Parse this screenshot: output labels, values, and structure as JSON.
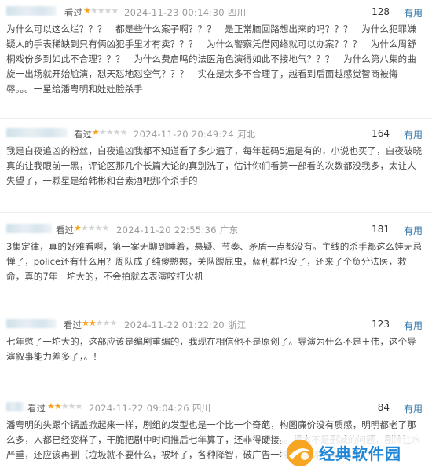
{
  "reviews": [
    {
      "status": "看过",
      "stars": 1,
      "date": "2024-11-23 00:14:30",
      "location": "四川",
      "useful_count": "128",
      "useful_label": "有用",
      "text": "为什么可以这么烂？？？　都是些什么案子啊？？？　是正常脑回路想出来的吗？？？　为什么犯罪嫌疑人的手表稀缺到只有俩凶犯手里才有卖？？？　为什么警察凭借网络就可以办案？？？　为什么周舒桐戏份多到如此不合理？？？　为什么费启鸣的法医角色演得如此不接地气？？？　为什么第八集的曲旋一出场就开始尬演，怼天怼地怼空气？？？　实在是太多不合理了，越看到后面越感觉智商被侮辱。。。一星给潘粤明和娃娃脸杀手"
    },
    {
      "status": "看过",
      "stars": 1,
      "date": "2024-11-20 20:49:24",
      "location": "河北",
      "useful_count": "164",
      "useful_label": "有用",
      "text": "我是白夜追凶的粉丝，白夜追凶我都不知道看了多少遍了，每年起码5遍是有的，小说也买了，白夜破晓真的让我眼前一黑，评论区那几个长篇大论的真别洗了，估计你们看第一部看的次数都没我多，太让人失望了，一颗星是给韩彬和音素酒吧那个杀手的"
    },
    {
      "status": "看过",
      "stars": 1,
      "date": "2024-11-20 22:55:36",
      "location": "广东",
      "useful_count": "181",
      "useful_label": "有用",
      "text": "3集定律，真的好难看啊，第一案无聊到睡着，悬疑、节奏、矛盾一点都没有。主线的杀手都这么娃无忌惮了，police还有什么用？周队成了纯傻憨憨，关队跟屁虫，蓝利群也没了，还来了个负分法医，救命，真的7年一坨大的，不会拍就去表演咬打火机"
    },
    {
      "status": "看过",
      "stars": 2,
      "date": "2024-11-22 01:22:20",
      "location": "浙江",
      "useful_count": "123",
      "useful_label": "有用",
      "text": "七年憋了一坨大的，这部应该是编剧重编的，我现在相信他不是原创了。导演为什么不是王伟，这个导演叙事能力差多了，。！"
    },
    {
      "status": "看过",
      "stars": 2,
      "date": "2024-11-22 09:04:26",
      "location": "四川",
      "useful_count": "84",
      "useful_label": "有用",
      "text": "潘粤明的头跟个锅盖掀起来一样，剧组的发型也是一个比一个奇葩，构图廉价没有质感，明明都老了那么多，人都已经变样了，干脆把剧中时间推后七年算了，还非得硬接。。根本不是删减的问题，剧情注水严重，还应该再删（垃圾就不要什么，被坏了，各种降智，破广告一堆。。白等七年，垃圾！！！"
    }
  ],
  "watermark": {
    "text": "经典软件园"
  }
}
